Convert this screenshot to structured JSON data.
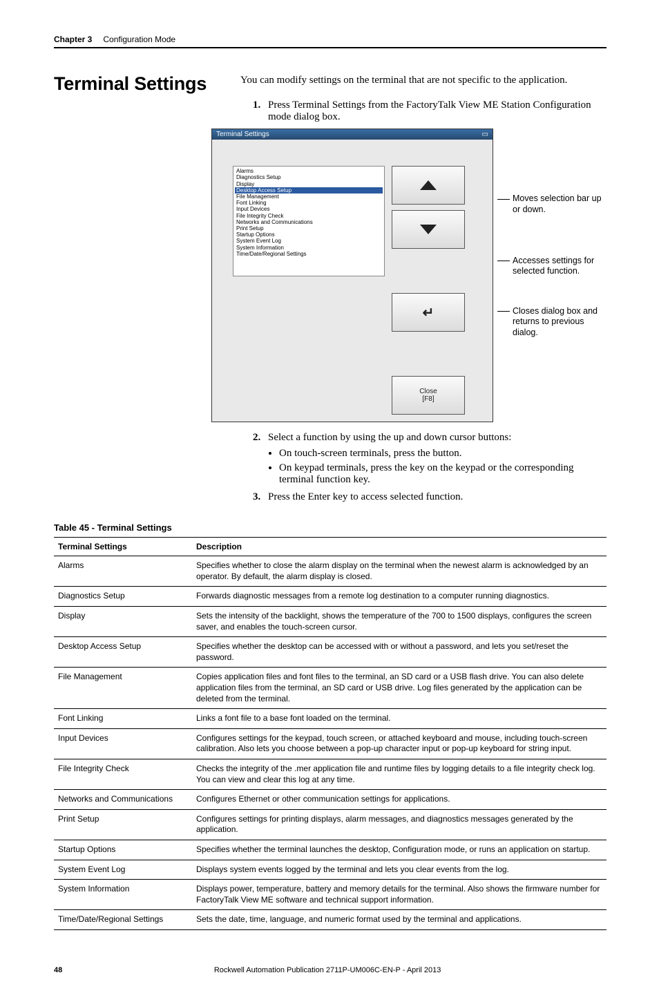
{
  "header": {
    "chapter": "Chapter 3",
    "title": "Configuration Mode"
  },
  "section": {
    "heading": "Terminal Settings",
    "intro": "You can modify settings on the terminal that are not specific to the application."
  },
  "steps": {
    "s1_num": "1.",
    "s1_text": "Press Terminal Settings from the FactoryTalk View ME Station Configuration mode dialog box.",
    "s2_num": "2.",
    "s2_text": "Select a function by using the up and down cursor buttons:",
    "s2_b1": "On touch-screen terminals, press the button.",
    "s2_b2": "On keypad terminals, press the key on the keypad or the corresponding terminal function key.",
    "s3_num": "3.",
    "s3_text": "Press the Enter key to access selected function."
  },
  "dialog": {
    "title": "Terminal Settings",
    "items": [
      "Alarms",
      "Diagnostics Setup",
      "Display",
      "Desktop Access Setup",
      "File Management",
      "Font Linking",
      "Input Devices",
      "File Integrity Check",
      "Networks and Communications",
      "Print Setup",
      "Startup Options",
      "System Event Log",
      "System Information",
      "Time/Date/Regional Settings"
    ],
    "selected_index": 3,
    "close_label": "Close\n[F8]"
  },
  "callouts": {
    "c1": "Moves selection bar up or down.",
    "c2": "Accesses settings for selected function.",
    "c3": "Closes dialog box and returns to previous dialog."
  },
  "table": {
    "caption": "Table 45 - Terminal Settings",
    "col1": "Terminal Settings",
    "col2": "Description",
    "rows": [
      {
        "name": "Alarms",
        "desc": "Specifies whether to close the alarm display on the terminal when the newest alarm is acknowledged by an operator. By default, the alarm display is closed."
      },
      {
        "name": "Diagnostics Setup",
        "desc": "Forwards diagnostic messages from a remote log destination to a computer running diagnostics."
      },
      {
        "name": "Display",
        "desc": "Sets the intensity of the backlight, shows the temperature of the 700 to 1500 displays, configures the screen saver, and enables the touch-screen cursor."
      },
      {
        "name": "Desktop Access Setup",
        "desc": "Specifies whether the desktop can be accessed with or without a password, and lets you set/reset the password."
      },
      {
        "name": "File Management",
        "desc": "Copies application files and font files to the terminal, an SD card or a USB flash drive. You can also delete application files from the terminal, an SD card or USB drive. Log files generated by the application can be deleted from the terminal."
      },
      {
        "name": "Font Linking",
        "desc": "Links a font file to a base font loaded on the terminal."
      },
      {
        "name": "Input Devices",
        "desc": "Configures settings for the keypad, touch screen, or attached keyboard and mouse, including touch-screen calibration. Also lets you choose between a pop-up character input or pop-up keyboard for string input."
      },
      {
        "name": "File Integrity Check",
        "desc": "Checks the integrity of the .mer application file and runtime files by logging details to a file integrity check log. You can view and clear this log at any time."
      },
      {
        "name": "Networks and Communications",
        "desc": "Configures Ethernet or other communication settings for applications."
      },
      {
        "name": "Print Setup",
        "desc": "Configures settings for printing displays, alarm messages, and diagnostics messages generated by the application."
      },
      {
        "name": "Startup Options",
        "desc": "Specifies whether the terminal launches the desktop, Configuration mode, or runs an application on startup."
      },
      {
        "name": "System Event Log",
        "desc": "Displays system events logged by the terminal and lets you clear events from the log."
      },
      {
        "name": "System Information",
        "desc": "Displays power, temperature, battery and memory details for the terminal. Also shows the firmware number for FactoryTalk View ME software and technical support information."
      },
      {
        "name": "Time/Date/Regional Settings",
        "desc": "Sets the date, time, language, and numeric format used by the terminal and applications."
      }
    ]
  },
  "footer": {
    "page": "48",
    "pub": "Rockwell Automation Publication 2711P-UM006C-EN-P - April 2013"
  }
}
